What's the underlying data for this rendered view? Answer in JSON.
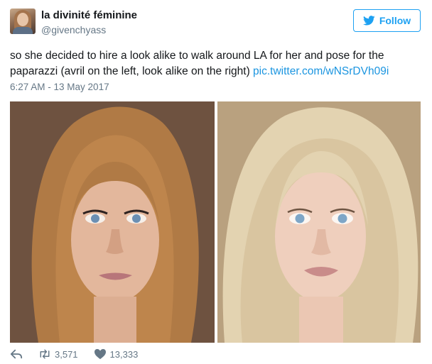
{
  "user": {
    "name": "la divinité féminine",
    "handle": "@givenchyass"
  },
  "follow": {
    "label": "Follow"
  },
  "tweet": {
    "text": "so she decided to hire a look alike to walk around LA for her and pose for the paparazzi (avril on the left, look alike on the right) ",
    "link": "pic.twitter.com/wNSrDVh09i",
    "timestamp": "6:27 AM - 13 May 2017"
  },
  "stats": {
    "retweets": "3,571",
    "likes": "13,333"
  },
  "colors": {
    "accent": "#1da1f2",
    "link": "#1b95e0",
    "muted": "#657786"
  }
}
